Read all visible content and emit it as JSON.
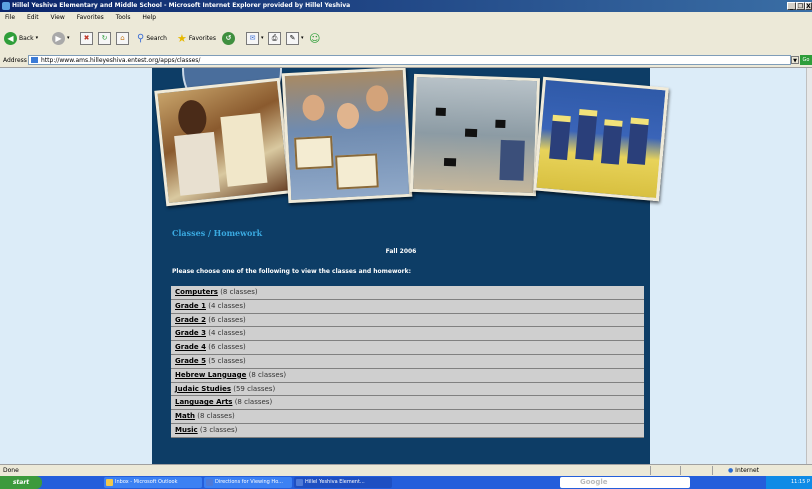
{
  "window": {
    "title": "Hillel Yeshiva Elementary and Middle School - Microsoft Internet Explorer provided by Hillel Yeshiva",
    "controls": [
      "_",
      "❐",
      "X"
    ]
  },
  "menubar": [
    "File",
    "Edit",
    "View",
    "Favorites",
    "Tools",
    "Help"
  ],
  "toolbar": {
    "back_label": "Back",
    "search_label": "Search",
    "favorites_label": "Favorites"
  },
  "address": {
    "label": "Address",
    "url": "http://www.ams.hilleyeshiva.entest.org/apps/classes/",
    "go_label": "Go"
  },
  "page": {
    "heading": "Classes / Homework",
    "term": "Fall 2006",
    "instruction": "Please choose one of the following to view the classes and homework:",
    "classes": [
      {
        "name": "Computers",
        "count": "(8 classes)"
      },
      {
        "name": "Grade 1",
        "count": "(4 classes)"
      },
      {
        "name": "Grade 2",
        "count": "(6 classes)"
      },
      {
        "name": "Grade 3",
        "count": "(4 classes)"
      },
      {
        "name": "Grade 4",
        "count": "(6 classes)"
      },
      {
        "name": "Grade 5",
        "count": "(5 classes)"
      },
      {
        "name": "Hebrew Language",
        "count": "(8 classes)"
      },
      {
        "name": "Judaic Studies",
        "count": "(59 classes)"
      },
      {
        "name": "Language Arts",
        "count": "(8 classes)"
      },
      {
        "name": "Math",
        "count": "(8 classes)"
      },
      {
        "name": "Music",
        "count": "(3 classes)"
      }
    ]
  },
  "statusbar": {
    "status": "Done",
    "zone": "Internet"
  },
  "taskbar": {
    "start_label": "start",
    "tasks": [
      {
        "label": "Inbox - Microsoft Outlook",
        "active": false
      },
      {
        "label": "Directions for Viewing Ho...",
        "active": false
      },
      {
        "label": "Hillel Yeshiva Element...",
        "active": true
      }
    ],
    "search_placeholder": "Google",
    "clock": "11:15 P"
  },
  "colors": {
    "page_background": "#dcecf8",
    "content_background": "#0d3d66",
    "heading": "#3aa9e0",
    "list_row": "#cfcfcf"
  }
}
